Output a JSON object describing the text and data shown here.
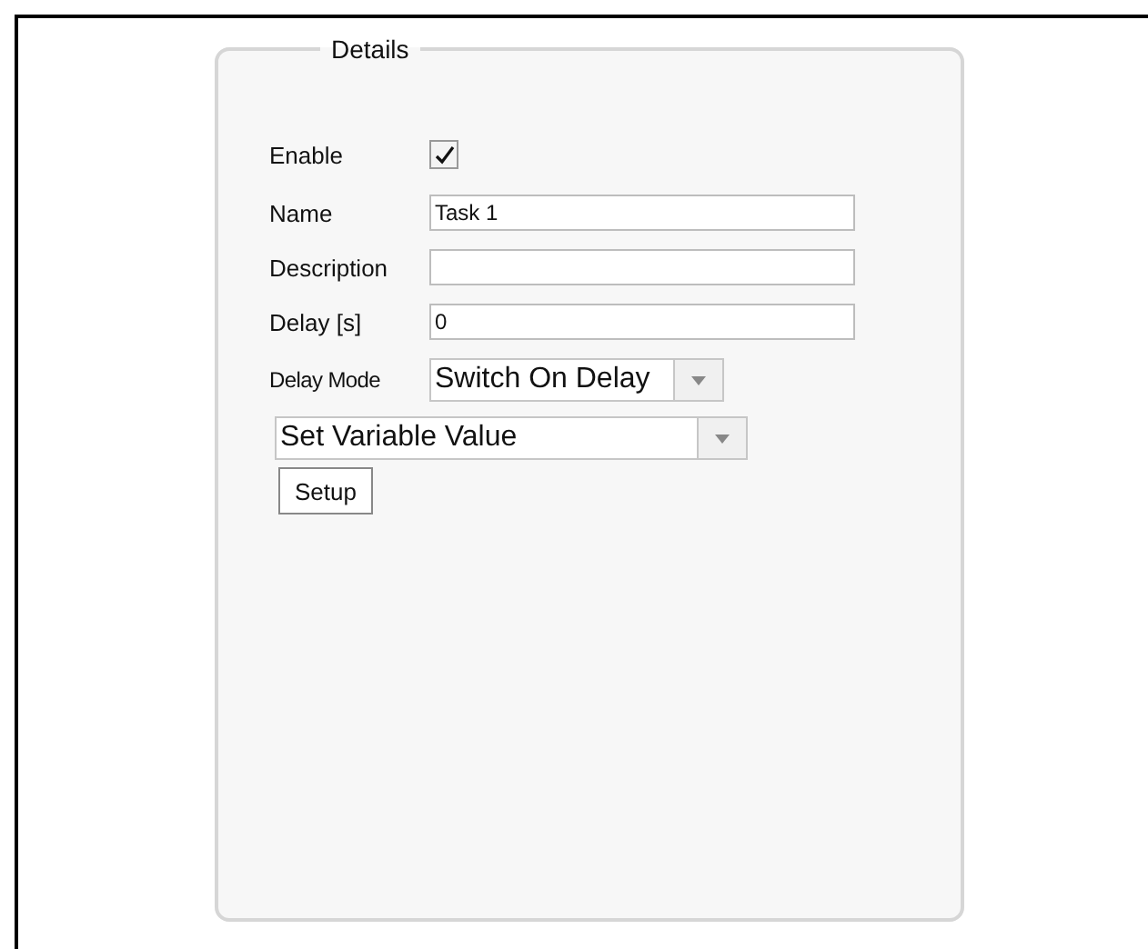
{
  "panel": {
    "title": "Details"
  },
  "enable": {
    "label": "Enable",
    "checked": true
  },
  "fields": [
    {
      "label": "Name",
      "value": "Task 1"
    },
    {
      "label": "Description"
    },
    {
      "label": "Delay [s]",
      "value": "0"
    }
  ],
  "delay_mode": {
    "label": "Delay Mode",
    "value": "Switch On Delay"
  },
  "action": {
    "value": "Set Variable Value"
  },
  "buttons": [
    "Setup"
  ]
}
